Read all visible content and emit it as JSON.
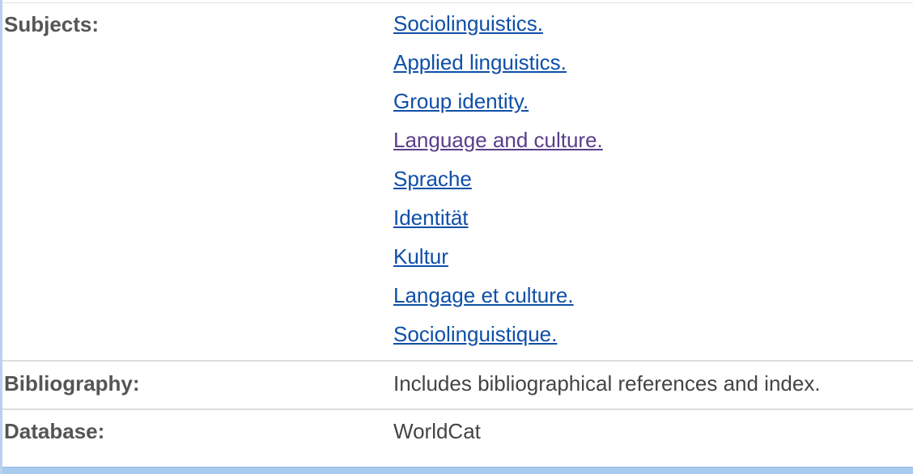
{
  "rows": {
    "subjects": {
      "label": "Subjects:",
      "links": [
        {
          "text": "Sociolinguistics.",
          "visited": false
        },
        {
          "text": "Applied linguistics.",
          "visited": false
        },
        {
          "text": "Group identity.",
          "visited": false
        },
        {
          "text": "Language and culture.",
          "visited": true
        },
        {
          "text": "Sprache",
          "visited": false
        },
        {
          "text": "Identität",
          "visited": false
        },
        {
          "text": "Kultur",
          "visited": false
        },
        {
          "text": "Langage et culture.",
          "visited": false
        },
        {
          "text": "Sociolinguistique.",
          "visited": false
        }
      ]
    },
    "bibliography": {
      "label": "Bibliography:",
      "value": "Includes bibliographical references and index."
    },
    "database": {
      "label": "Database:",
      "value": "WorldCat"
    }
  },
  "colors": {
    "link": "#0f4fa8",
    "visited_link": "#5a3e8a",
    "label": "#555555",
    "accent_border": "#b8d2ee"
  }
}
